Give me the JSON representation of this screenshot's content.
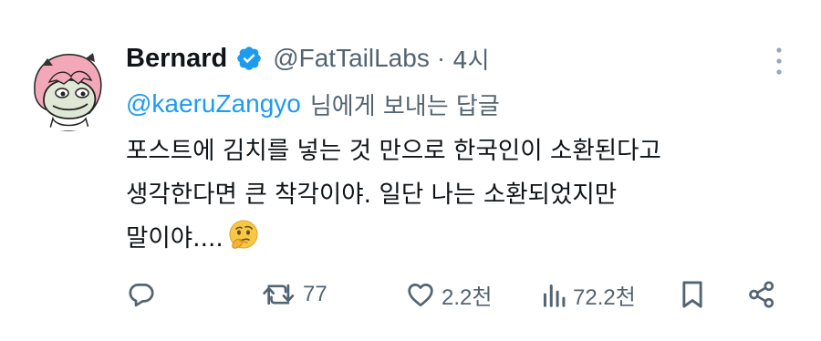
{
  "tweet": {
    "author_name": "Bernard",
    "handle": "@FatTailLabs",
    "separator": "·",
    "time": "4시",
    "reply_to_handle": "@kaeruZangyo",
    "reply_to_suffix": "님에게 보내는 답글",
    "body_lines": [
      "포스트에 김치를 넣는 것 만으로 한국인이 소환된다고",
      "생각한다면 큰 착각이야. 일단 나는 소환되었지만",
      "말이야...."
    ],
    "emoji": "thinking-face"
  },
  "actions": {
    "reply": {
      "icon": "reply-icon",
      "count": ""
    },
    "retweet": {
      "icon": "retweet-icon",
      "count": "77"
    },
    "like": {
      "icon": "heart-icon",
      "count": "2.2천"
    },
    "views": {
      "icon": "views-icon",
      "count": "72.2천"
    },
    "bookmark": {
      "icon": "bookmark-icon"
    },
    "share": {
      "icon": "share-icon"
    }
  },
  "colors": {
    "text_primary": "#0f1419",
    "text_secondary": "#536471",
    "accent": "#1d9bf0",
    "avatar_hair": "#f2a8b8"
  }
}
